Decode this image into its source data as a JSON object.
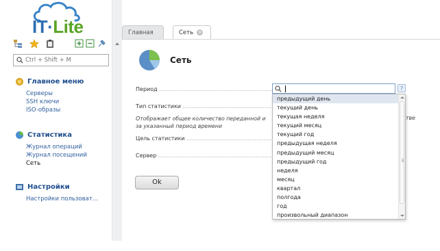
{
  "logo": {
    "text_it": "IT",
    "text_dot": "·",
    "text_lite": "Lite"
  },
  "toolbar": {
    "icons": [
      "tree-icon",
      "star-icon",
      "clipboard-icon",
      "expand-icon",
      "collapse-icon",
      "pin-icon"
    ]
  },
  "search": {
    "placeholder": "Ctrl + Shift + M"
  },
  "sidebar": {
    "main_menu": {
      "title": "Главное меню",
      "items": [
        "Серверы",
        "SSH ключи",
        "ISO-образы"
      ]
    },
    "statistics": {
      "title": "Статистика",
      "items": [
        "Журнал операций",
        "Журнал посещений",
        "Сеть"
      ]
    },
    "settings": {
      "title": "Настройки",
      "items": [
        "Настройки пользоват..."
      ]
    }
  },
  "tabs": [
    {
      "label": "Главная"
    },
    {
      "label": "Сеть"
    }
  ],
  "page": {
    "title": "Сеть",
    "fields": {
      "period": "Период",
      "stat_type": "Тип статистики",
      "stat_goal": "Цель статистики",
      "server": "Сервер"
    },
    "description": "Отображает общее количество переданной и",
    "description_line2": "за указанный период времени",
    "description_tail": "тве",
    "ok_label": "Ok"
  },
  "dropdown": {
    "help_label": "?",
    "selected_index": 0,
    "options": [
      "предыдущий день",
      "текущий день",
      "текущая неделя",
      "текущий месяц",
      "текущий год",
      "предыдущая неделя",
      "предыдущий месяц",
      "предыдущий год",
      "неделя",
      "месяц",
      "квартал",
      "полгода",
      "год",
      "произвольный диапазон"
    ]
  }
}
